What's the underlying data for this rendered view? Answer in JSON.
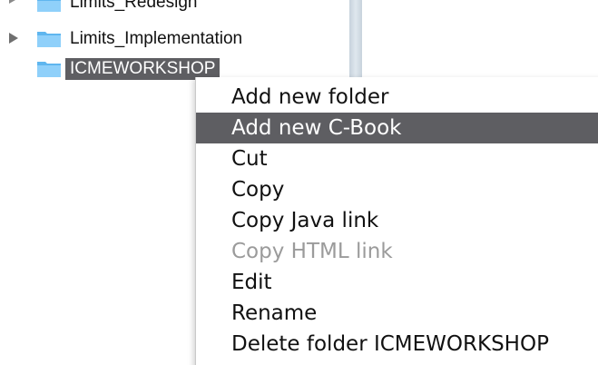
{
  "tree": {
    "items": [
      {
        "label": "Limits_Redesign",
        "icon": "folder-icon",
        "expandable": true,
        "selected": false
      },
      {
        "label": "Limits_Implementation",
        "icon": "folder-icon",
        "expandable": true,
        "selected": false
      },
      {
        "label": "ICMEWORKSHOP",
        "icon": "folder-icon",
        "expandable": false,
        "selected": true
      }
    ]
  },
  "context_menu": {
    "items": [
      {
        "label": "Add new folder",
        "state": "normal"
      },
      {
        "label": "Add new C-Book",
        "state": "highlighted"
      },
      {
        "label": "Cut",
        "state": "normal"
      },
      {
        "label": "Copy",
        "state": "normal"
      },
      {
        "label": "Copy Java link",
        "state": "normal"
      },
      {
        "label": "Copy HTML link",
        "state": "disabled"
      },
      {
        "label": "Edit",
        "state": "normal"
      },
      {
        "label": "Rename",
        "state": "normal"
      },
      {
        "label": "Delete folder ICMEWORKSHOP",
        "state": "normal"
      }
    ]
  },
  "colors": {
    "selection": "#5e5e62",
    "folder": "#5fb6ef",
    "disabled_text": "#9b9b9b"
  }
}
